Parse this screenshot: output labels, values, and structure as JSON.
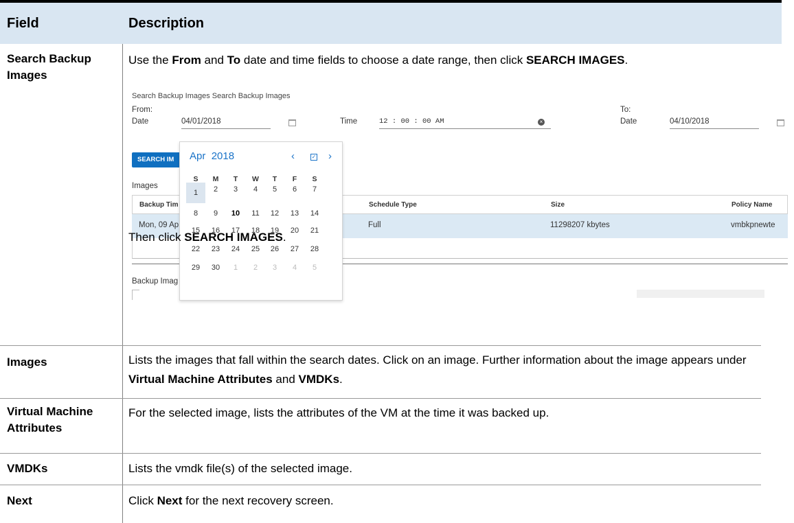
{
  "table": {
    "header_field": "Field",
    "header_description": "Description"
  },
  "rows": {
    "search": {
      "field_line1": "Search Backup",
      "field_line2": "Images",
      "desc_pre": "Use the ",
      "desc_from": "From",
      "desc_and": " and ",
      "desc_to": "To",
      "desc_mid": " date and time fields to choose a date range, then click ",
      "desc_btn": "SEARCH IMAGES",
      "desc_end": ".",
      "after_pre": "Then click ",
      "after_btn": "SEARCH IMAGES",
      "after_end": "."
    },
    "images": {
      "field": "Images",
      "desc_pre": "Lists the images that fall within the search dates. Click on an image. Further information about the image appears under ",
      "desc_b1": "Virtual Machine Attributes",
      "desc_and": " and ",
      "desc_b2": "VMDKs",
      "desc_end": "."
    },
    "vm": {
      "field_line1": "Virtual Machine",
      "field_line2": "Attributes",
      "desc": "For the selected image, lists the attributes of the VM at the time it was backed up."
    },
    "vmdks": {
      "field": "VMDKs",
      "desc": "Lists the vmdk file(s) of the selected image."
    },
    "next": {
      "field": "Next",
      "desc_pre": "Click ",
      "desc_b": "Next",
      "desc_end": " for the next recovery screen."
    }
  },
  "screenshot": {
    "panel_title": "Search Backup Images Search Backup Images",
    "from_label": "From:",
    "to_label": "To:",
    "date_label": "Date",
    "time_label": "Time",
    "from_date": "04/01/2018",
    "from_time": "12 : 00 : 00  AM",
    "to_date": "04/10/2018",
    "search_button": "SEARCH IM",
    "images_label": "Images",
    "columns": {
      "backup_time": "Backup Tim",
      "schedule_type": "Schedule Type",
      "size": "Size",
      "policy_name": "Policy Name"
    },
    "row": {
      "backup_time": "Mon, 09 Ap",
      "schedule_type": "Full",
      "size": "11298207 kbytes",
      "policy_name": "vmbkpnewte"
    },
    "lower_label": "Backup Imag",
    "calendar": {
      "month": "Apr",
      "year": "2018",
      "prev_icon": "chevron-left-icon",
      "next_icon": "chevron-right-icon",
      "today_icon": "check-square-icon",
      "weekdays": [
        "S",
        "M",
        "T",
        "W",
        "T",
        "F",
        "S"
      ],
      "weeks": [
        [
          "1",
          "2",
          "3",
          "4",
          "5",
          "6",
          "7"
        ],
        [
          "8",
          "9",
          "10",
          "11",
          "12",
          "13",
          "14"
        ],
        [
          "15",
          "16",
          "17",
          "18",
          "19",
          "20",
          "21"
        ],
        [
          "22",
          "23",
          "24",
          "25",
          "26",
          "27",
          "28"
        ],
        [
          "29",
          "30",
          "1",
          "2",
          "3",
          "4",
          "5"
        ]
      ],
      "selected_day": "1",
      "today_day": "10"
    }
  },
  "colors": {
    "header_bg": "#d9e6f2",
    "accent_blue": "#0f6fc0",
    "selected_row_bg": "#dbe9f4"
  }
}
